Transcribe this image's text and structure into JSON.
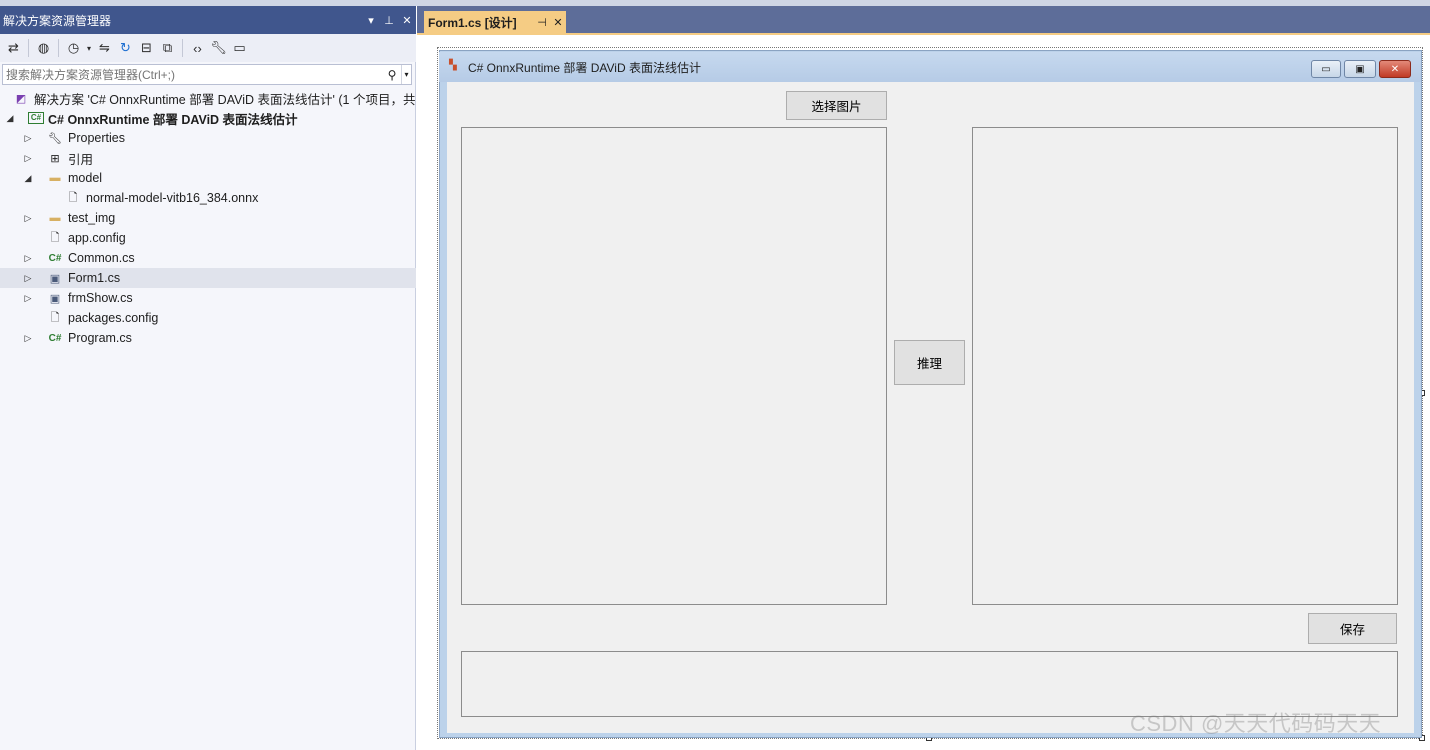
{
  "solution_explorer": {
    "title": "解决方案资源管理器",
    "title_controls": [
      "▾",
      "⊥",
      "✕"
    ],
    "toolbar_icons": [
      "switch-views-icon",
      "globe-icon",
      "history-icon",
      "dropdown-arrow-icon",
      "sync-icon",
      "refresh-icon",
      "collapse-all-icon",
      "copy-icon",
      "code-icon",
      "wrench-icon",
      "preview-icon"
    ],
    "search_placeholder": "搜索解决方案资源管理器(Ctrl+;)",
    "tree": {
      "solution": "解决方案 'C# OnnxRuntime 部署 DAViD  表面法线估计' (1 个项目，共",
      "project": "C# OnnxRuntime 部署 DAViD  表面法线估计",
      "items": [
        {
          "label": "Properties"
        },
        {
          "label": "引用"
        },
        {
          "label": "model"
        },
        {
          "label": "normal-model-vitb16_384.onnx"
        },
        {
          "label": "test_img"
        },
        {
          "label": "app.config"
        },
        {
          "label": "Common.cs"
        },
        {
          "label": "Form1.cs"
        },
        {
          "label": "frmShow.cs"
        },
        {
          "label": "packages.config"
        },
        {
          "label": "Program.cs"
        }
      ]
    }
  },
  "document": {
    "tab_label": "Form1.cs [设计]",
    "tab_pin": "⊣",
    "tab_close": "✕"
  },
  "form": {
    "title": "C# OnnxRuntime 部署 DAViD  表面法线估计",
    "select_button": "选择图片",
    "infer_button": "推理",
    "save_button": "保存",
    "window_buttons": [
      "▭",
      "▣",
      "✕"
    ]
  },
  "watermark": "CSDN @天天代码码天天",
  "colors": {
    "tool_window_title": "#40568d",
    "active_tab": "#f5cc84",
    "form_caption": "#bcd2ea",
    "form_client": "#f0f0f0"
  }
}
